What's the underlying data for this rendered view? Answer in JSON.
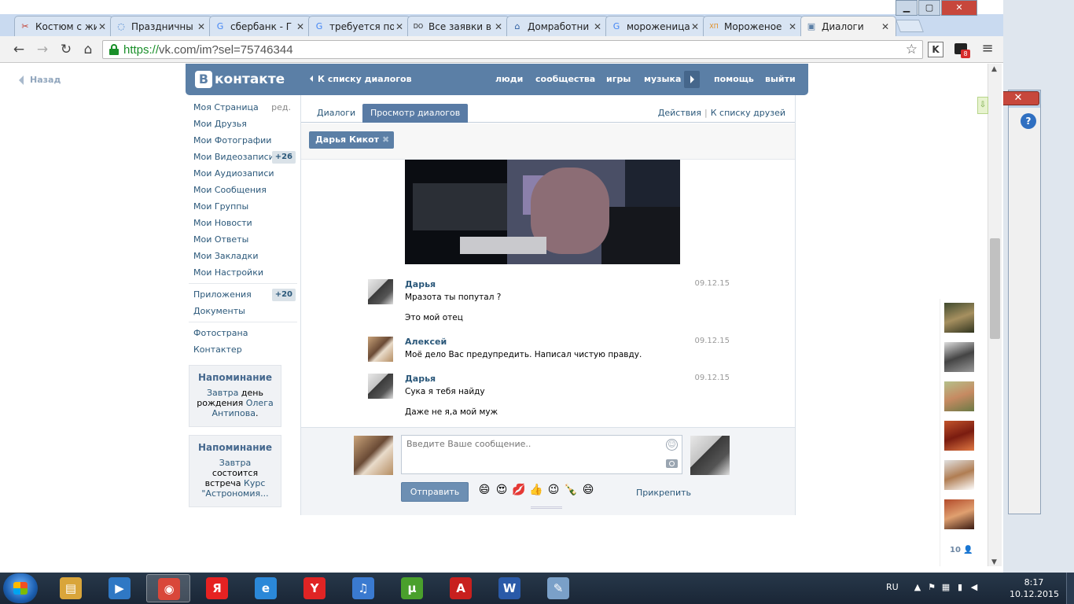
{
  "browser": {
    "tabs": [
      {
        "label": "Костюм с жи",
        "favicon": "scissors-icon",
        "favicon_color": "#c0392b",
        "glyph": "✂"
      },
      {
        "label": "Праздничны",
        "favicon": "loading-icon",
        "favicon_color": "#2a70c8",
        "glyph": "◌"
      },
      {
        "label": "сбербанк - Г",
        "favicon": "google-icon",
        "favicon_color": "#4285f4",
        "glyph": "G"
      },
      {
        "label": "требуется по",
        "favicon": "google-icon",
        "favicon_color": "#4285f4",
        "glyph": "G"
      },
      {
        "label": "Все заявки в",
        "favicon": "do-icon",
        "favicon_color": "#222222",
        "glyph": "DO"
      },
      {
        "label": "Домработни",
        "favicon": "house-icon",
        "favicon_color": "#2a5ba0",
        "glyph": "⌂"
      },
      {
        "label": "мороженица",
        "favicon": "google-icon",
        "favicon_color": "#4285f4",
        "glyph": "G"
      },
      {
        "label": "Мороженое",
        "favicon": "xp-icon",
        "favicon_color": "#e08a1e",
        "glyph": "ХП"
      },
      {
        "label": "Диалоги",
        "favicon": "vk-dialog-icon",
        "favicon_color": "#5b7fa6",
        "glyph": "▣"
      }
    ],
    "active_tab": 8,
    "url_scheme": "https://",
    "url_rest": "vk.com/im?sel=75746344",
    "extension_k": "K",
    "extension_badge": "8"
  },
  "vk": {
    "back": "Назад",
    "logo": "контакте",
    "logo_letter": "В",
    "to_dialogs": "К списку диалогов",
    "nav": [
      "люди",
      "сообщества",
      "игры",
      "музыка",
      "помощь",
      "выйти"
    ],
    "menu": [
      {
        "label": "Моя Страница",
        "extra": "ред."
      },
      {
        "label": "Мои Друзья"
      },
      {
        "label": "Мои Фотографии"
      },
      {
        "label": "Мои Видеозаписи",
        "count": "+26"
      },
      {
        "label": "Мои Аудиозаписи"
      },
      {
        "label": "Мои Сообщения"
      },
      {
        "label": "Мои Группы"
      },
      {
        "label": "Мои Новости"
      },
      {
        "label": "Мои Ответы"
      },
      {
        "label": "Мои Закладки"
      },
      {
        "label": "Мои Настройки"
      }
    ],
    "menu2": [
      {
        "label": "Приложения",
        "count": "+20"
      },
      {
        "label": "Документы"
      }
    ],
    "menu3": [
      {
        "label": "Фотострана"
      },
      {
        "label": "Контактер"
      }
    ],
    "reminders": [
      {
        "title": "Напоминание",
        "when": "Завтра",
        "text": "день рождения",
        "link": "Олега Антипова",
        "tail": "."
      },
      {
        "title": "Напоминание",
        "when": "Завтра",
        "text": "состоится встреча",
        "link": "Курс \"Астрономия...",
        "tail": ""
      }
    ],
    "dialog_tabs": [
      "Диалоги",
      "Просмотр диалогов"
    ],
    "actions": "Действия",
    "to_friends": "К списку друзей",
    "peer": "Дарья Кикот",
    "messages": [
      {
        "author": "Дарья",
        "date": "09.12.15",
        "lines": [
          "Мразота ты попутал ?",
          "Это мой отец"
        ],
        "avatar": "female"
      },
      {
        "author": "Алексей",
        "date": "09.12.15",
        "lines": [
          "Моё дело Вас предупредить. Написал чистую правду."
        ],
        "avatar": "male"
      },
      {
        "author": "Дарья",
        "date": "09.12.15",
        "lines": [
          "Сука я тебя найду",
          "Даже не я,а мой муж"
        ],
        "avatar": "female"
      }
    ],
    "compose_placeholder": "Введите Ваше сообщение..",
    "send": "Отправить",
    "attach": "Прикрепить",
    "emojis": [
      "😄",
      "😍",
      "💋",
      "👍",
      "😉",
      "🍾",
      "😄"
    ],
    "friends_count": "10"
  },
  "taskbar": {
    "apps": [
      {
        "name": "explorer",
        "glyph": "▤",
        "color": "#d9a53a"
      },
      {
        "name": "media-player",
        "glyph": "▶",
        "color": "#2f78c4"
      },
      {
        "name": "chrome",
        "glyph": "◉",
        "color": "#d9473a"
      },
      {
        "name": "yandex",
        "glyph": "Я",
        "color": "#e62222"
      },
      {
        "name": "ie",
        "glyph": "e",
        "color": "#2b88d8"
      },
      {
        "name": "yandex-browser",
        "glyph": "Y",
        "color": "#e02424"
      },
      {
        "name": "audio",
        "glyph": "♫",
        "color": "#3a7ad0"
      },
      {
        "name": "utorrent",
        "glyph": "μ",
        "color": "#4aa02c"
      },
      {
        "name": "pdf",
        "glyph": "A",
        "color": "#c8201e"
      },
      {
        "name": "word",
        "glyph": "W",
        "color": "#2a5aa8"
      },
      {
        "name": "paint",
        "glyph": "✎",
        "color": "#7aa0c8"
      }
    ],
    "active_app": 2,
    "lang": "RU",
    "time": "8:17",
    "date": "10.12.2015"
  }
}
